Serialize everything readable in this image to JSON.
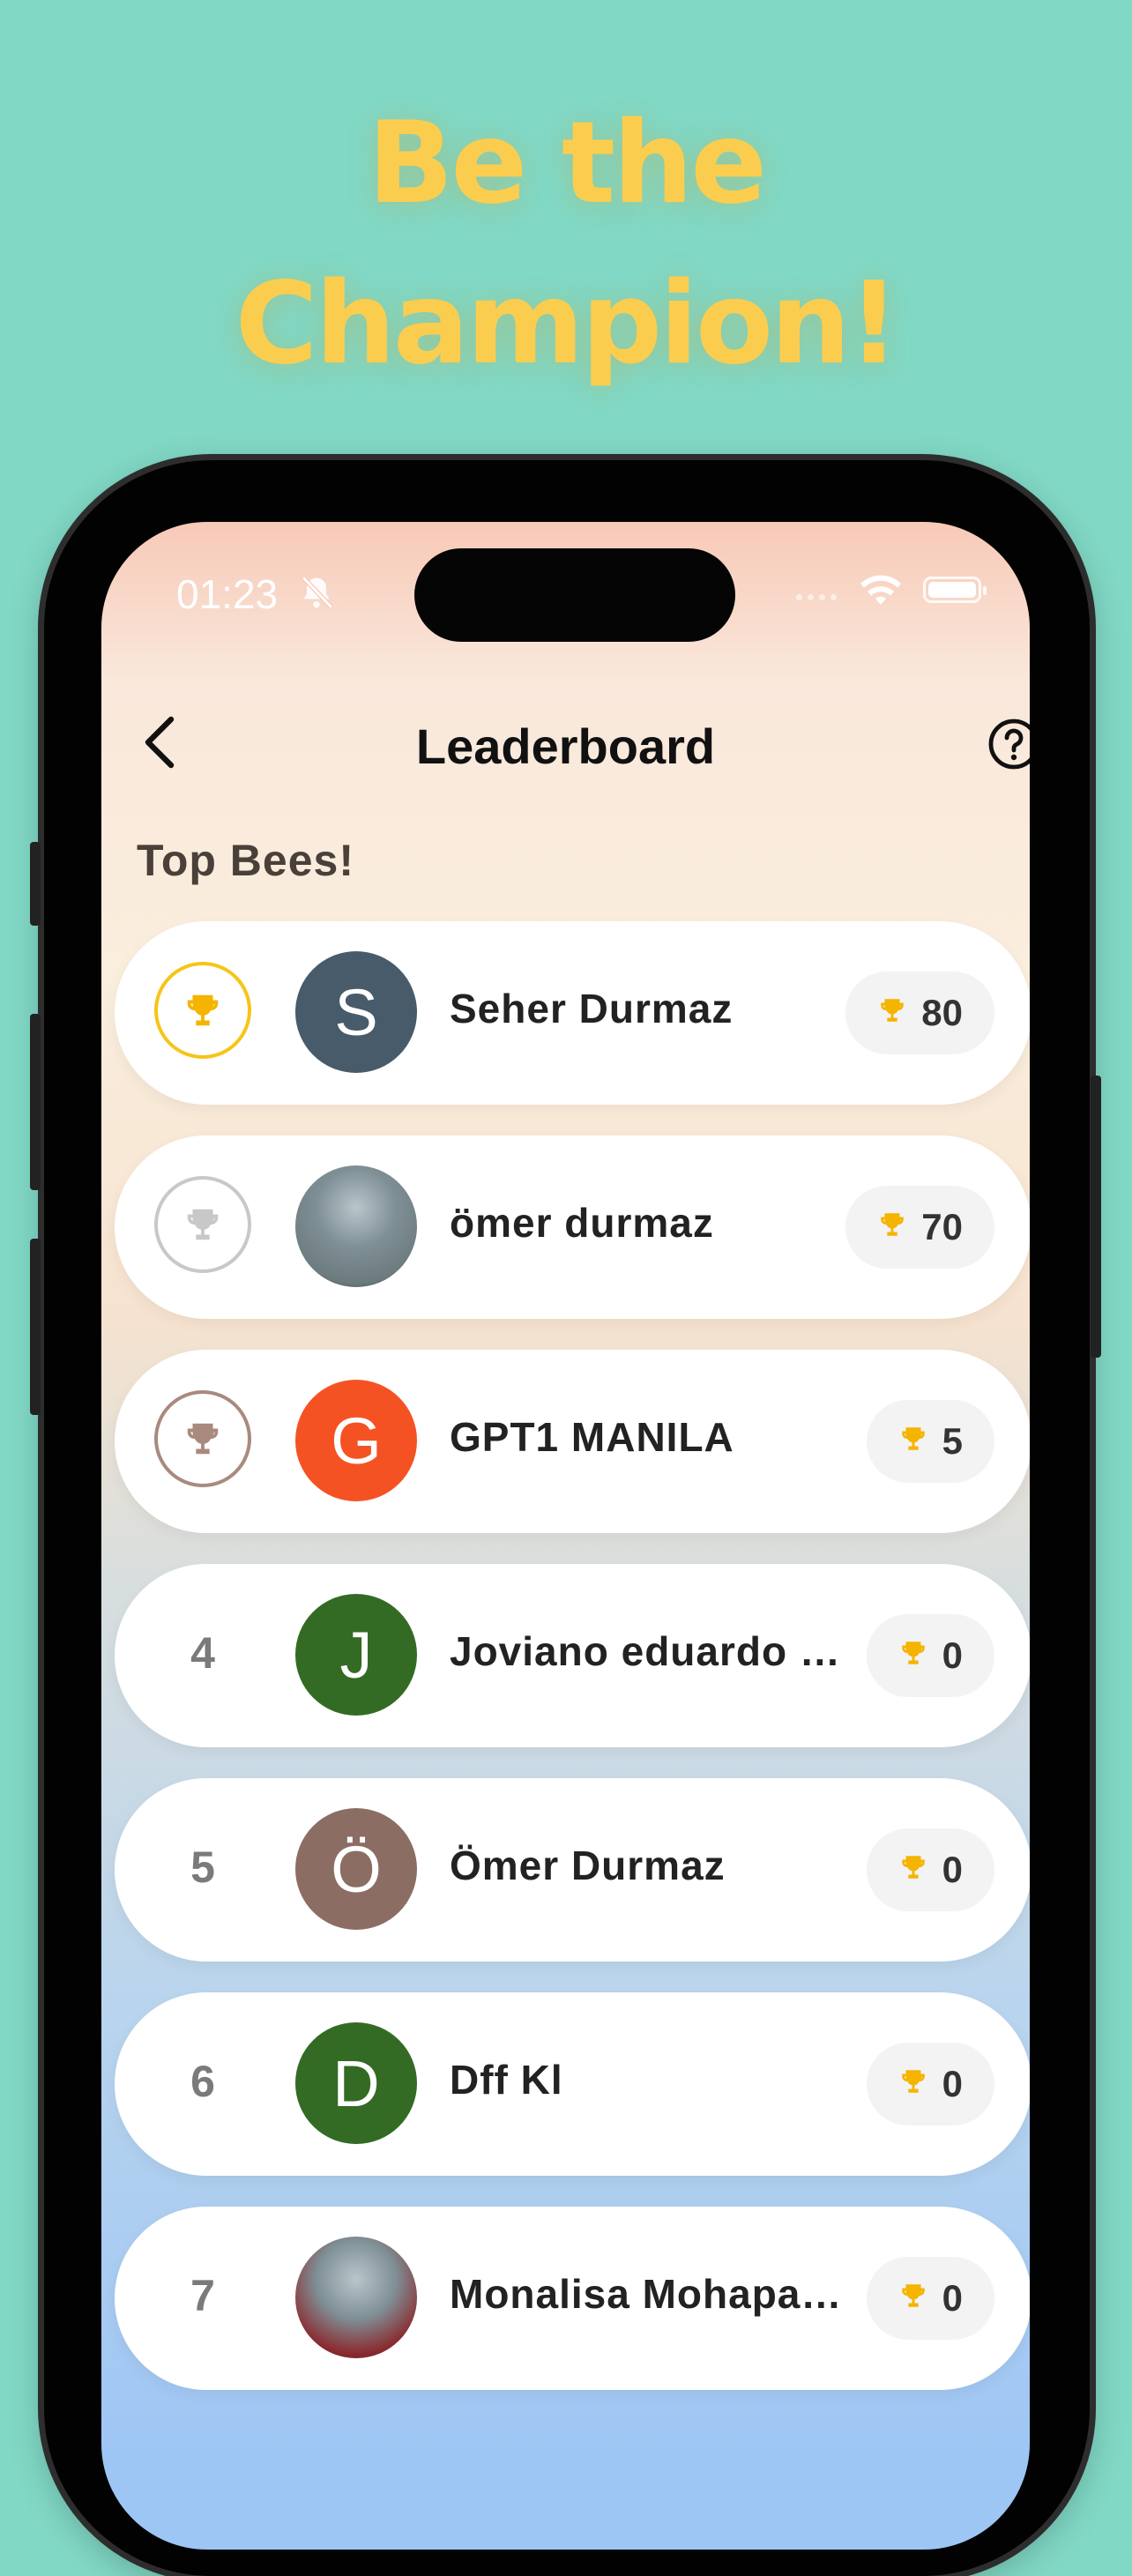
{
  "promo": {
    "line1": "Be the",
    "line2": "Champion!"
  },
  "status_bar": {
    "time": "01:23"
  },
  "header": {
    "title": "Leaderboard"
  },
  "section_title": "Top Bees!",
  "colors": {
    "gold": "#f5c518",
    "silver": "#c8c8c8",
    "bronze": "#a98a7d",
    "trophy": "#f4b400"
  },
  "leaderboard": [
    {
      "rank": "1",
      "name": "Seher Durmaz",
      "score": "80",
      "avatar_letter": "S",
      "avatar_color": "#475b6a",
      "badge": "gold"
    },
    {
      "rank": "2",
      "name": "ömer durmaz",
      "score": "70",
      "avatar_letter": "",
      "avatar_color": "#6c7b7e",
      "badge": "silver"
    },
    {
      "rank": "3",
      "name": "GPT1 MANILA",
      "score": "5",
      "avatar_letter": "G",
      "avatar_color": "#f55223",
      "badge": "bronze"
    },
    {
      "rank": "4",
      "name": "Joviano eduardo …",
      "score": "0",
      "avatar_letter": "J",
      "avatar_color": "#336b24",
      "badge": ""
    },
    {
      "rank": "5",
      "name": "Ömer Durmaz",
      "score": "0",
      "avatar_letter": "Ö",
      "avatar_color": "#8c6d63",
      "badge": ""
    },
    {
      "rank": "6",
      "name": "Dff Kl",
      "score": "0",
      "avatar_letter": "D",
      "avatar_color": "#336b24",
      "badge": ""
    },
    {
      "rank": "7",
      "name": "Monalisa Mohapa…",
      "score": "0",
      "avatar_letter": "",
      "avatar_color": "#8a2a2e",
      "badge": ""
    }
  ]
}
